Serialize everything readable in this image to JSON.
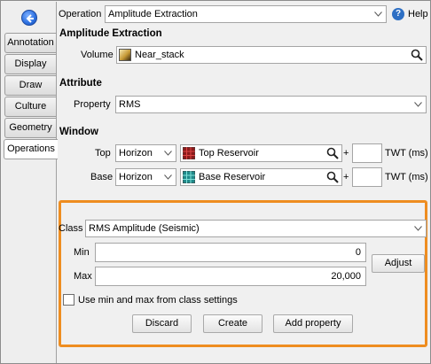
{
  "tabs": {
    "items": [
      "Annotation",
      "Display",
      "Draw",
      "Culture",
      "Geometry",
      "Operations"
    ],
    "active": "Operations"
  },
  "operation": {
    "label": "Operation",
    "selected": "Amplitude Extraction",
    "help_label": "Help"
  },
  "amplitude_extraction": {
    "heading": "Amplitude Extraction",
    "volume_label": "Volume",
    "volume_value": "Near_stack"
  },
  "attribute": {
    "heading": "Attribute",
    "property_label": "Property",
    "property_value": "RMS"
  },
  "window": {
    "heading": "Window",
    "top": {
      "label": "Top",
      "type": "Horizon",
      "horizon": "Top Reservoir",
      "plus": "+",
      "offset": "",
      "unit": "TWT (ms)"
    },
    "base": {
      "label": "Base",
      "type": "Horizon",
      "horizon": "Base Reservoir",
      "plus": "+",
      "offset": "",
      "unit": "TWT (ms)"
    }
  },
  "class_section": {
    "class_label": "Class",
    "class_value": "RMS Amplitude (Seismic)",
    "min_label": "Min",
    "min_value": "0",
    "max_label": "Max",
    "max_value": "20,000",
    "adjust_label": "Adjust",
    "checkbox_label": "Use min and max from class settings",
    "checkbox_checked": false
  },
  "actions": {
    "discard": "Discard",
    "create": "Create",
    "add_property": "Add property"
  },
  "colors": {
    "highlight": "#ee8d20",
    "top_horizon_icon": "#8b1a1a",
    "base_horizon_icon": "#1f8a8a"
  },
  "icons": [
    "back-arrow-icon",
    "help-icon",
    "magnify-icon",
    "volume-icon",
    "horizon-icon",
    "chevron-down-icon"
  ]
}
